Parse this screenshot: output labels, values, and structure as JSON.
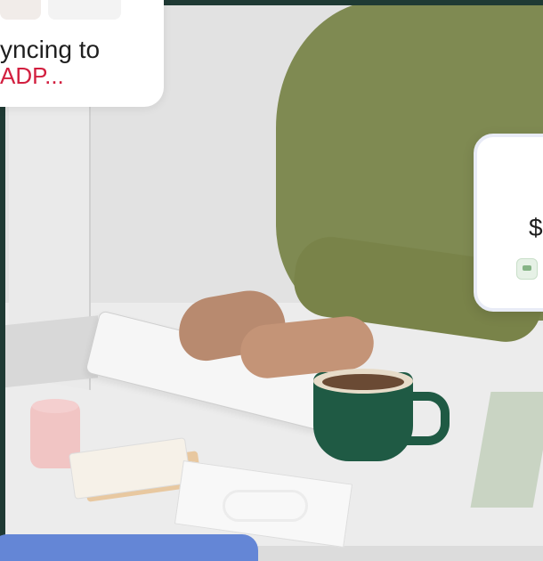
{
  "sync_popup": {
    "line1": "yncing to",
    "line2": "ADP..."
  },
  "amount_card": {
    "amount": "$"
  },
  "colors": {
    "accent_red": "#d21f3f",
    "frame_green": "#1f3a34",
    "blue_bar": "#6486d6"
  }
}
